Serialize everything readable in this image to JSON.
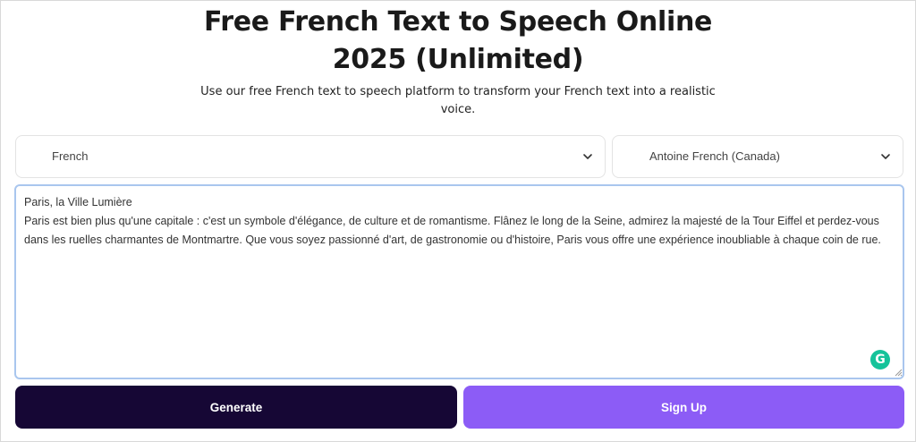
{
  "header": {
    "title_line1": "Free French Text to Speech Online",
    "title_line2": "2025 (Unlimited)",
    "subtitle": "Use our free French text to speech platform to transform your French text into a realistic voice."
  },
  "controls": {
    "language": "French",
    "voice": "Antoine French (Canada)"
  },
  "editor": {
    "line1": "Paris, la Ville Lumière",
    "body": "Paris est bien plus qu'une capitale : c'est un symbole d'élégance, de culture et de romantisme. Flânez le long de la Seine, admirez la majesté de la Tour Eiffel et perdez-vous dans les ruelles charmantes de Montmartre. Que vous soyez passionné d'art, de gastronomie ou d'histoire, Paris vous offre une expérience inoubliable à chaque coin de rue."
  },
  "buttons": {
    "generate": "Generate",
    "signup": "Sign Up"
  },
  "colors": {
    "generate_bg": "#160735",
    "signup_bg": "#8c5cf6",
    "textarea_border": "#a9c6ee",
    "grammarly": "#15c39a"
  },
  "icons": {
    "dropdown": "chevron-down-icon",
    "grammarly": "grammarly-icon",
    "resize": "resize-handle-icon"
  }
}
